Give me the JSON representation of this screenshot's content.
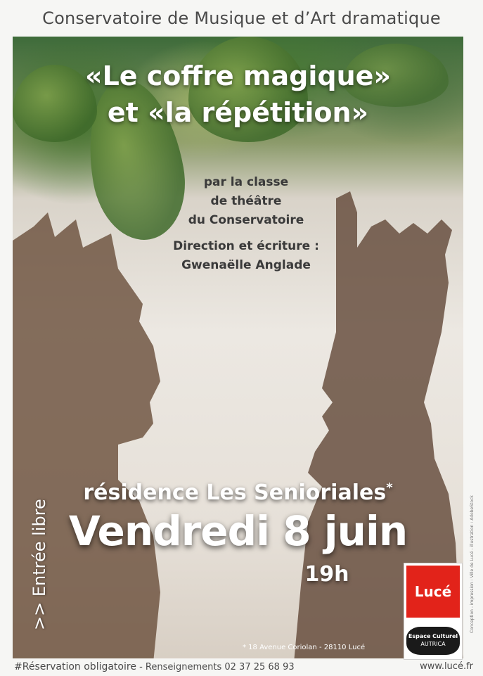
{
  "header": {
    "title": "Conservatoire de Musique et d’Art dramatique"
  },
  "poster": {
    "title_line1": "«Le coffre magique»",
    "title_line2": "et «la répétition»",
    "credits": {
      "line1": "par la classe",
      "line2": "de théâtre",
      "line3": "du Conservatoire",
      "direction_label": "Direction et écriture :",
      "director": "Gwenaëlle Anglade"
    },
    "venue": "résidence Les Senioriales",
    "venue_asterisk": "*",
    "date": "Vendredi 8 juin",
    "time": "19h",
    "entry": ">> Entrée libre",
    "address": "* 18 Avenue Coriolan - 28110 Lucé"
  },
  "logos": {
    "luce": "Lucé",
    "luce_color": "#e2231a",
    "espace_line1": "Espace Culturel",
    "espace_line2": "AUTRICA"
  },
  "side_credit": "Conception - impression : Ville de Lucé - illustration : AdobeStock",
  "footer": {
    "reservation": "#Réservation obligatoire",
    "separator": " - ",
    "info": "Renseignements 02 37 25 68 93",
    "website": "www.lucé.fr"
  }
}
